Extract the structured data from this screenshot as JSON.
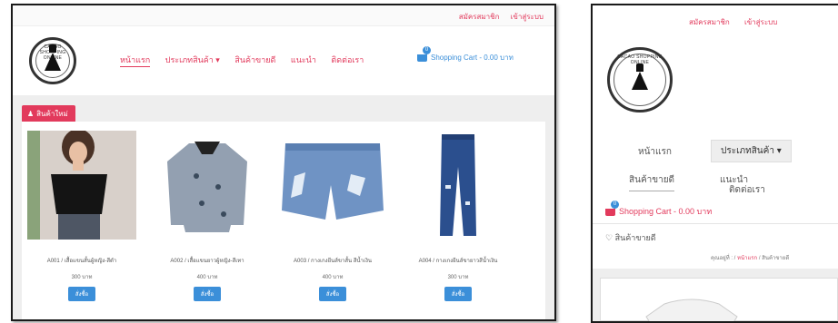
{
  "desktop": {
    "top_links": [
      "สมัครสมาชิก",
      "เข้าสู่ระบบ"
    ],
    "logo_text": "CACAO SHOPPING ONLINE",
    "nav": [
      "หน้าแรก",
      "ประเภทสินค้า ▾",
      "สินค้าขายดี",
      "แนะนำ",
      "ติดต่อเรา"
    ],
    "cart": {
      "count": "0",
      "label": "Shopping Cart - 0.00 บาท"
    },
    "section_badge": "สินค้าใหม่",
    "products": [
      {
        "name": "A001 / เสื้อแขนสั้นผู้หญิง-สีดำ",
        "price": "300 บาท",
        "button": "สั่งซื้อ"
      },
      {
        "name": "A002 / เสื้อแขนยาวผู้หญิง-สีเทา",
        "price": "400 บาท",
        "button": "สั่งซื้อ"
      },
      {
        "name": "A003 / กางเกงยีนส์ขาสั้น สีน้ำเงิน",
        "price": "400 บาท",
        "button": "สั่งซื้อ"
      },
      {
        "name": "A004 / กางเกงยีนส์ขายาวสีน้ำเงิน",
        "price": "300 บาท",
        "button": "สั่งซื้อ"
      }
    ]
  },
  "mobile": {
    "top_links": [
      "สมัครสมาชิก",
      "เข้าสู่ระบบ"
    ],
    "logo_text": "CACAO SHOPPING ONLINE",
    "nav": [
      "หน้าแรก",
      "ประเภทสินค้า ▾",
      "สินค้าขายดี",
      "แนะนำ",
      "ติดต่อเรา"
    ],
    "cart": {
      "count": "0",
      "label": "Shopping Cart - 0.00 บาท"
    },
    "section_title": "สินค้าขายดี",
    "breadcrumb": {
      "prefix": "คุณอยู่ที่ :",
      "sep": "/",
      "home": "หน้าแรก",
      "current": "สินค้าขายดี"
    }
  }
}
